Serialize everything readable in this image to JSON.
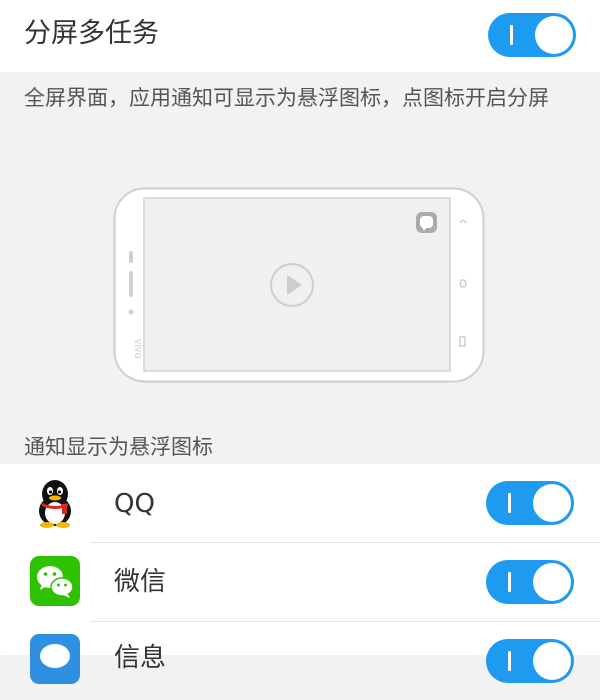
{
  "split_screen": {
    "title": "分屏多任务",
    "toggle_on": true,
    "description": "全屏界面，应用通知可显示为悬浮图标，点图标开启分屏"
  },
  "illustration": {
    "brand_text": "vivo"
  },
  "notification_section": {
    "label": "通知显示为悬浮图标",
    "apps": [
      {
        "name": "QQ",
        "icon": "qq-penguin-icon",
        "toggle_on": true
      },
      {
        "name": "微信",
        "icon": "wechat-icon",
        "toggle_on": true
      },
      {
        "name": "信息",
        "icon": "messages-icon",
        "toggle_on": true
      }
    ]
  },
  "colors": {
    "accent": "#1e9af0",
    "wechat_green": "#2dc100",
    "messages_blue": "#2f8fe0"
  }
}
